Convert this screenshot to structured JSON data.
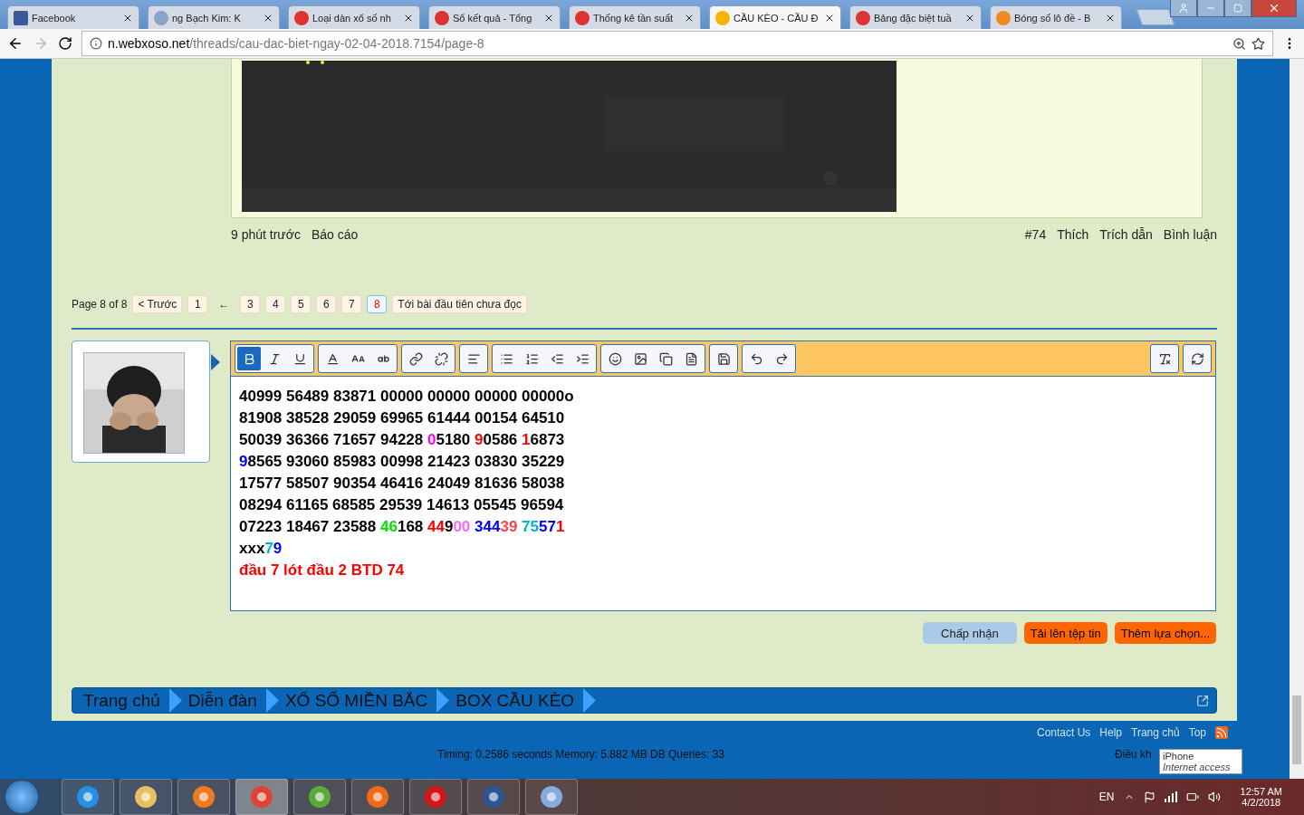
{
  "browser": {
    "tabs": [
      {
        "kind": "facebook",
        "title": "Facebook",
        "selected": false
      },
      {
        "kind": "page",
        "title": "ng Bạch Kim: K",
        "selected": false
      },
      {
        "kind": "lottery",
        "title": "Loại dàn xổ số nh",
        "selected": false
      },
      {
        "kind": "lottery",
        "title": "Sổ kết quả - Tổng",
        "selected": false
      },
      {
        "kind": "lottery",
        "title": "Thống kê tần suất",
        "selected": false
      },
      {
        "kind": "xs",
        "title": "CẦU KÈO - CẦU Đ",
        "selected": true
      },
      {
        "kind": "lottery",
        "title": "Bảng đặc biệt tuầ",
        "selected": false
      },
      {
        "kind": "ball",
        "title": "Bóng số lô đề - B",
        "selected": false
      }
    ],
    "url_host": "n.webxoso.net",
    "url_path": "/threads/cau-dac-biet-ngay-02-04-2018.7154/page-8"
  },
  "post": {
    "meta_left": [
      "9 phút trước",
      "Báo cáo"
    ],
    "meta_right": [
      "#74",
      "Thích",
      "Trích dẫn",
      "Bình luận"
    ]
  },
  "pagination": {
    "label": "Page 8 of 8",
    "items": [
      {
        "kind": "button",
        "text": "< Trước",
        "selected": false
      },
      {
        "kind": "button",
        "text": "1",
        "selected": false
      },
      {
        "kind": "gap",
        "text": "←"
      },
      {
        "kind": "button",
        "text": "3",
        "selected": false
      },
      {
        "kind": "button",
        "text": "4",
        "selected": false
      },
      {
        "kind": "button",
        "text": "5",
        "selected": false
      },
      {
        "kind": "button",
        "text": "6",
        "selected": false
      },
      {
        "kind": "button",
        "text": "7",
        "selected": false
      },
      {
        "kind": "button",
        "text": "8",
        "selected": true
      },
      {
        "kind": "button",
        "text": "Tới bài đầu tiên chưa đọc",
        "selected": false
      }
    ]
  },
  "editor": {
    "bold_active": true,
    "lines": [
      [
        {
          "text": "40999 56489 83871 00000 00000 00000 00000o",
          "color": "#000000"
        }
      ],
      [
        {
          "text": "81908 38528 29059 69965 61444 00154 64510",
          "color": "#000000"
        }
      ],
      [
        {
          "text": "50039 36366 71657 94228 ",
          "color": "#000000"
        },
        {
          "text": "0",
          "color": "#ff00ff"
        },
        {
          "text": "5180 ",
          "color": "#000000"
        },
        {
          "text": "9",
          "color": "#ff0000"
        },
        {
          "text": "0586 ",
          "color": "#000000"
        },
        {
          "text": "1",
          "color": "#ff0000"
        },
        {
          "text": "6873",
          "color": "#000000"
        }
      ],
      [
        {
          "text": "9",
          "color": "#0000ff"
        },
        {
          "text": "8565 93060 85983 00998 21423 03830 35229",
          "color": "#000000"
        }
      ],
      [
        {
          "text": "17577 58507 90354 46416 24049 81636 58038",
          "color": "#000000"
        }
      ],
      [
        {
          "text": "08294 61165 68585 29539 14613 05545 96594",
          "color": "#000000"
        }
      ],
      [
        {
          "text": "07223 18467 23588 ",
          "color": "#000000"
        },
        {
          "text": "46",
          "color": "#00dd00"
        },
        {
          "text": "168 ",
          "color": "#000000"
        },
        {
          "text": "44",
          "color": "#ff0000"
        },
        {
          "text": "9",
          "color": "#000000"
        },
        {
          "text": "00 ",
          "color": "#ff66ff"
        },
        {
          "text": "344",
          "color": "#0000ff"
        },
        {
          "text": "39 ",
          "color": "#ff4444"
        },
        {
          "text": "75",
          "color": "#00b4c8"
        },
        {
          "text": "57",
          "color": "#0000ff"
        },
        {
          "text": "1",
          "color": "#ff0000"
        }
      ],
      [
        {
          "text": "xxx",
          "color": "#000000"
        },
        {
          "text": "7",
          "color": "#00b4c8"
        },
        {
          "text": "9",
          "color": "#0000ff"
        }
      ],
      [
        {
          "text": "đầu 7 lót đầu 2 BTD 74",
          "color": "#ff0000"
        }
      ]
    ]
  },
  "actions": [
    {
      "kind": "primary",
      "text": "Chấp nhận"
    },
    {
      "kind": "orange",
      "text": "Tải lên tệp tin"
    },
    {
      "kind": "orange",
      "text": "Thêm lựa chọn..."
    }
  ],
  "breadcrumb": [
    "Trang chủ",
    "Diễn đàn",
    "XỔ SỐ MIỀN BẮC",
    "BOX CẦU KÈO"
  ],
  "footer": {
    "links": [
      "Contact Us",
      "Help",
      "Trang chủ",
      "Top"
    ],
    "timing": "Timing: 0.2586 seconds Memory: 5.882 MB DB Queries: 33",
    "terms": "Điều kh"
  },
  "tooltip": {
    "title": "iPhone",
    "subtitle": "Internet access"
  },
  "taskbar": {
    "apps": [
      {
        "kind": "ie",
        "selected": false
      },
      {
        "kind": "folder",
        "selected": false
      },
      {
        "kind": "media",
        "selected": false
      },
      {
        "kind": "chrome",
        "selected": true
      },
      {
        "kind": "coccoc",
        "selected": false
      },
      {
        "kind": "firefox",
        "selected": false
      },
      {
        "kind": "garena",
        "selected": false
      },
      {
        "kind": "word",
        "selected": false
      },
      {
        "kind": "paint",
        "selected": false
      }
    ],
    "lang": "EN",
    "time": "12:57 AM",
    "date": "4/2/2018"
  }
}
